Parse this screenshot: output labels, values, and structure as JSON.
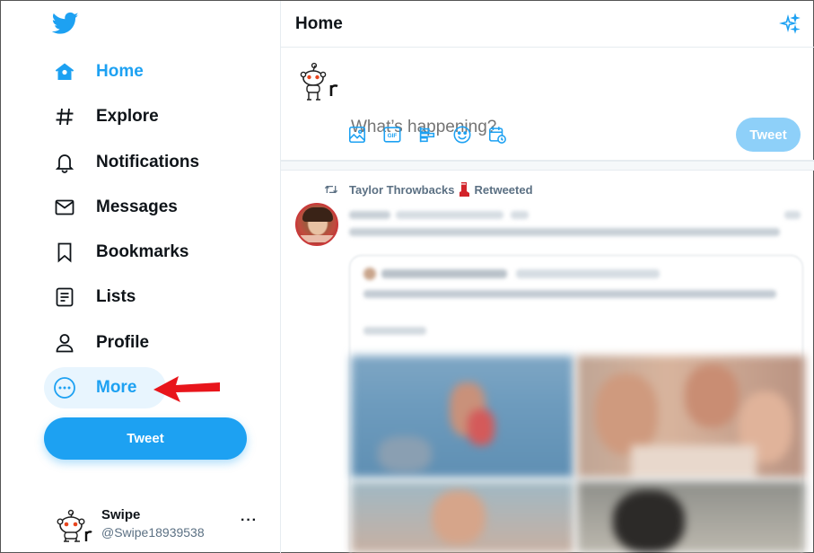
{
  "sidebar": {
    "nav": [
      {
        "label": "Home",
        "icon": "home-icon"
      },
      {
        "label": "Explore",
        "icon": "hashtag-icon"
      },
      {
        "label": "Notifications",
        "icon": "bell-icon"
      },
      {
        "label": "Messages",
        "icon": "envelope-icon"
      },
      {
        "label": "Bookmarks",
        "icon": "bookmark-icon"
      },
      {
        "label": "Lists",
        "icon": "list-icon"
      },
      {
        "label": "Profile",
        "icon": "person-icon"
      },
      {
        "label": "More",
        "icon": "more-circle-icon"
      }
    ],
    "tweet_button": "Tweet",
    "account": {
      "name": "Swipe",
      "handle": "@Swipe18939538",
      "menu": "···"
    }
  },
  "main": {
    "title": "Home",
    "composer": {
      "placeholder": "What’s happening?",
      "tools": [
        "image-icon",
        "gif-icon",
        "poll-icon",
        "emoji-icon",
        "schedule-icon"
      ],
      "tweet_button": "Tweet"
    },
    "feed": {
      "retweet_user": "Taylor Throwbacks",
      "retweet_suffix": "Retweeted"
    }
  },
  "colors": {
    "brand": "#1da1f2",
    "brand_disabled": "#8ed0f9",
    "arrow": "#e8151b"
  }
}
